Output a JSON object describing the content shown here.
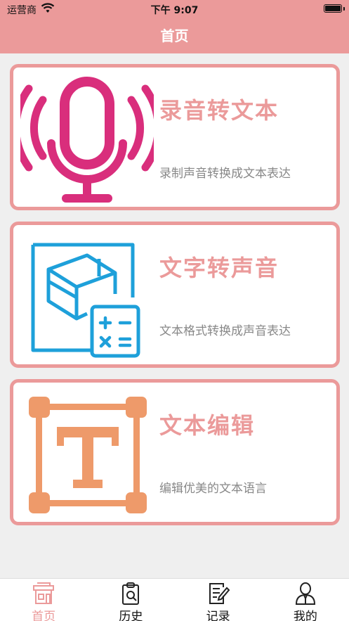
{
  "status_bar": {
    "carrier": "运营商",
    "time": "下午 9:07"
  },
  "nav": {
    "title": "首页"
  },
  "cards": [
    {
      "title": "录音转文本",
      "subtitle": "录制声音转换成文本表达",
      "icon": "microphone-icon",
      "icon_color": "#d92e7c"
    },
    {
      "title": "文字转声音",
      "subtitle": "文本格式转换成声音表达",
      "icon": "cube-calculator-icon",
      "icon_color": "#1ea0da"
    },
    {
      "title": "文本编辑",
      "subtitle": "编辑优美的文本语言",
      "icon": "text-frame-icon",
      "icon_color": "#ee9a6a"
    }
  ],
  "tabs": [
    {
      "label": "首页",
      "icon": "home-shop-icon",
      "active": true
    },
    {
      "label": "历史",
      "icon": "clipboard-search-icon",
      "active": false
    },
    {
      "label": "记录",
      "icon": "note-edit-icon",
      "active": false
    },
    {
      "label": "我的",
      "icon": "user-icon",
      "active": false
    }
  ],
  "colors": {
    "accent": "#eb9a9a",
    "subtitle": "#888888",
    "background": "#efefef"
  }
}
